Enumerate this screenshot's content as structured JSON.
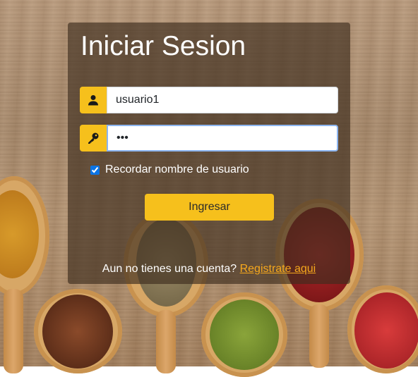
{
  "title": "Iniciar Sesion",
  "username": {
    "value": "usuario1",
    "icon": "user-icon"
  },
  "password": {
    "value": "•••",
    "icon": "key-icon"
  },
  "remember": {
    "label": "Recordar nombre de usuario",
    "checked": true
  },
  "login_button": "Ingresar",
  "signup": {
    "text": "Aun no tienes una cuenta?",
    "link": "Registrate aqui"
  },
  "colors": {
    "accent": "#f6c01c",
    "link": "#f6a81c",
    "panel": "rgba(62,46,30,0.66)"
  }
}
